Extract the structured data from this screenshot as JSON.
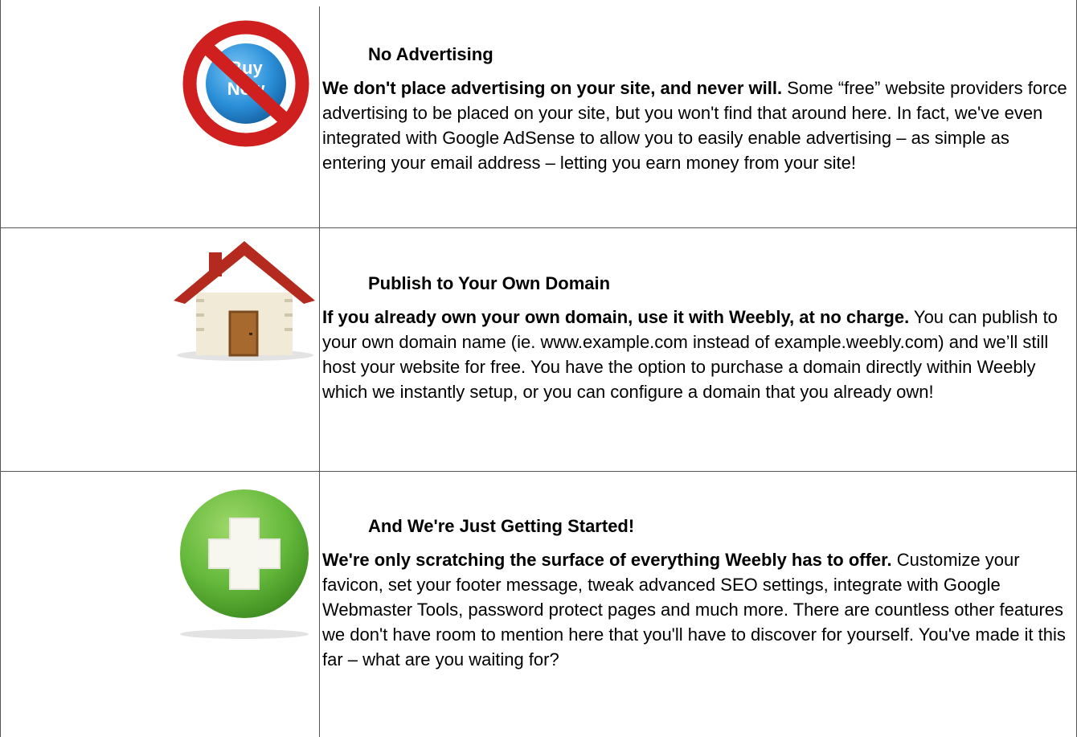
{
  "rows": [
    {
      "icon": "no-advertising-icon",
      "title": "No Advertising",
      "lead": "We don't place advertising on your site, and never will.",
      "body": " Some “free” website providers force advertising to be placed on your site, but you won't find that around here. In fact, we've even integrated with Google AdSense to allow you to easily enable advertising – as simple as entering your email address – letting you earn money from your site!"
    },
    {
      "icon": "house-icon",
      "title": "Publish to Your Own Domain",
      "lead": "If you already own your own domain, use it with Weebly, at no charge.",
      "body": " You can publish to your own domain name (ie. www.example.com instead of example.weebly.com) and we’ll still host your website for free. You have the option to purchase a domain directly within Weebly which we instantly setup, or you can configure a domain that you already own!"
    },
    {
      "icon": "plus-icon",
      "title": "And We're Just Getting Started!",
      "lead": "We're only scratching the surface of everything Weebly has to offer.",
      "body": " Customize your favicon, set your footer message, tweak advanced SEO settings, integrate with Google Webmaster Tools, password protect pages and much more. There are countless other features we don't have room to mention here that you'll have to discover for yourself. You've made it this far – what are you waiting for?"
    }
  ],
  "no_ad_icon_text": [
    "Buy",
    "Now"
  ],
  "colors": {
    "border": "#555555",
    "red": "#d01f1f",
    "blue": "#2a8fd8",
    "green": "#63b83a",
    "roof": "#b42a1f",
    "wall": "#f1ead6",
    "door": "#a8692e"
  }
}
